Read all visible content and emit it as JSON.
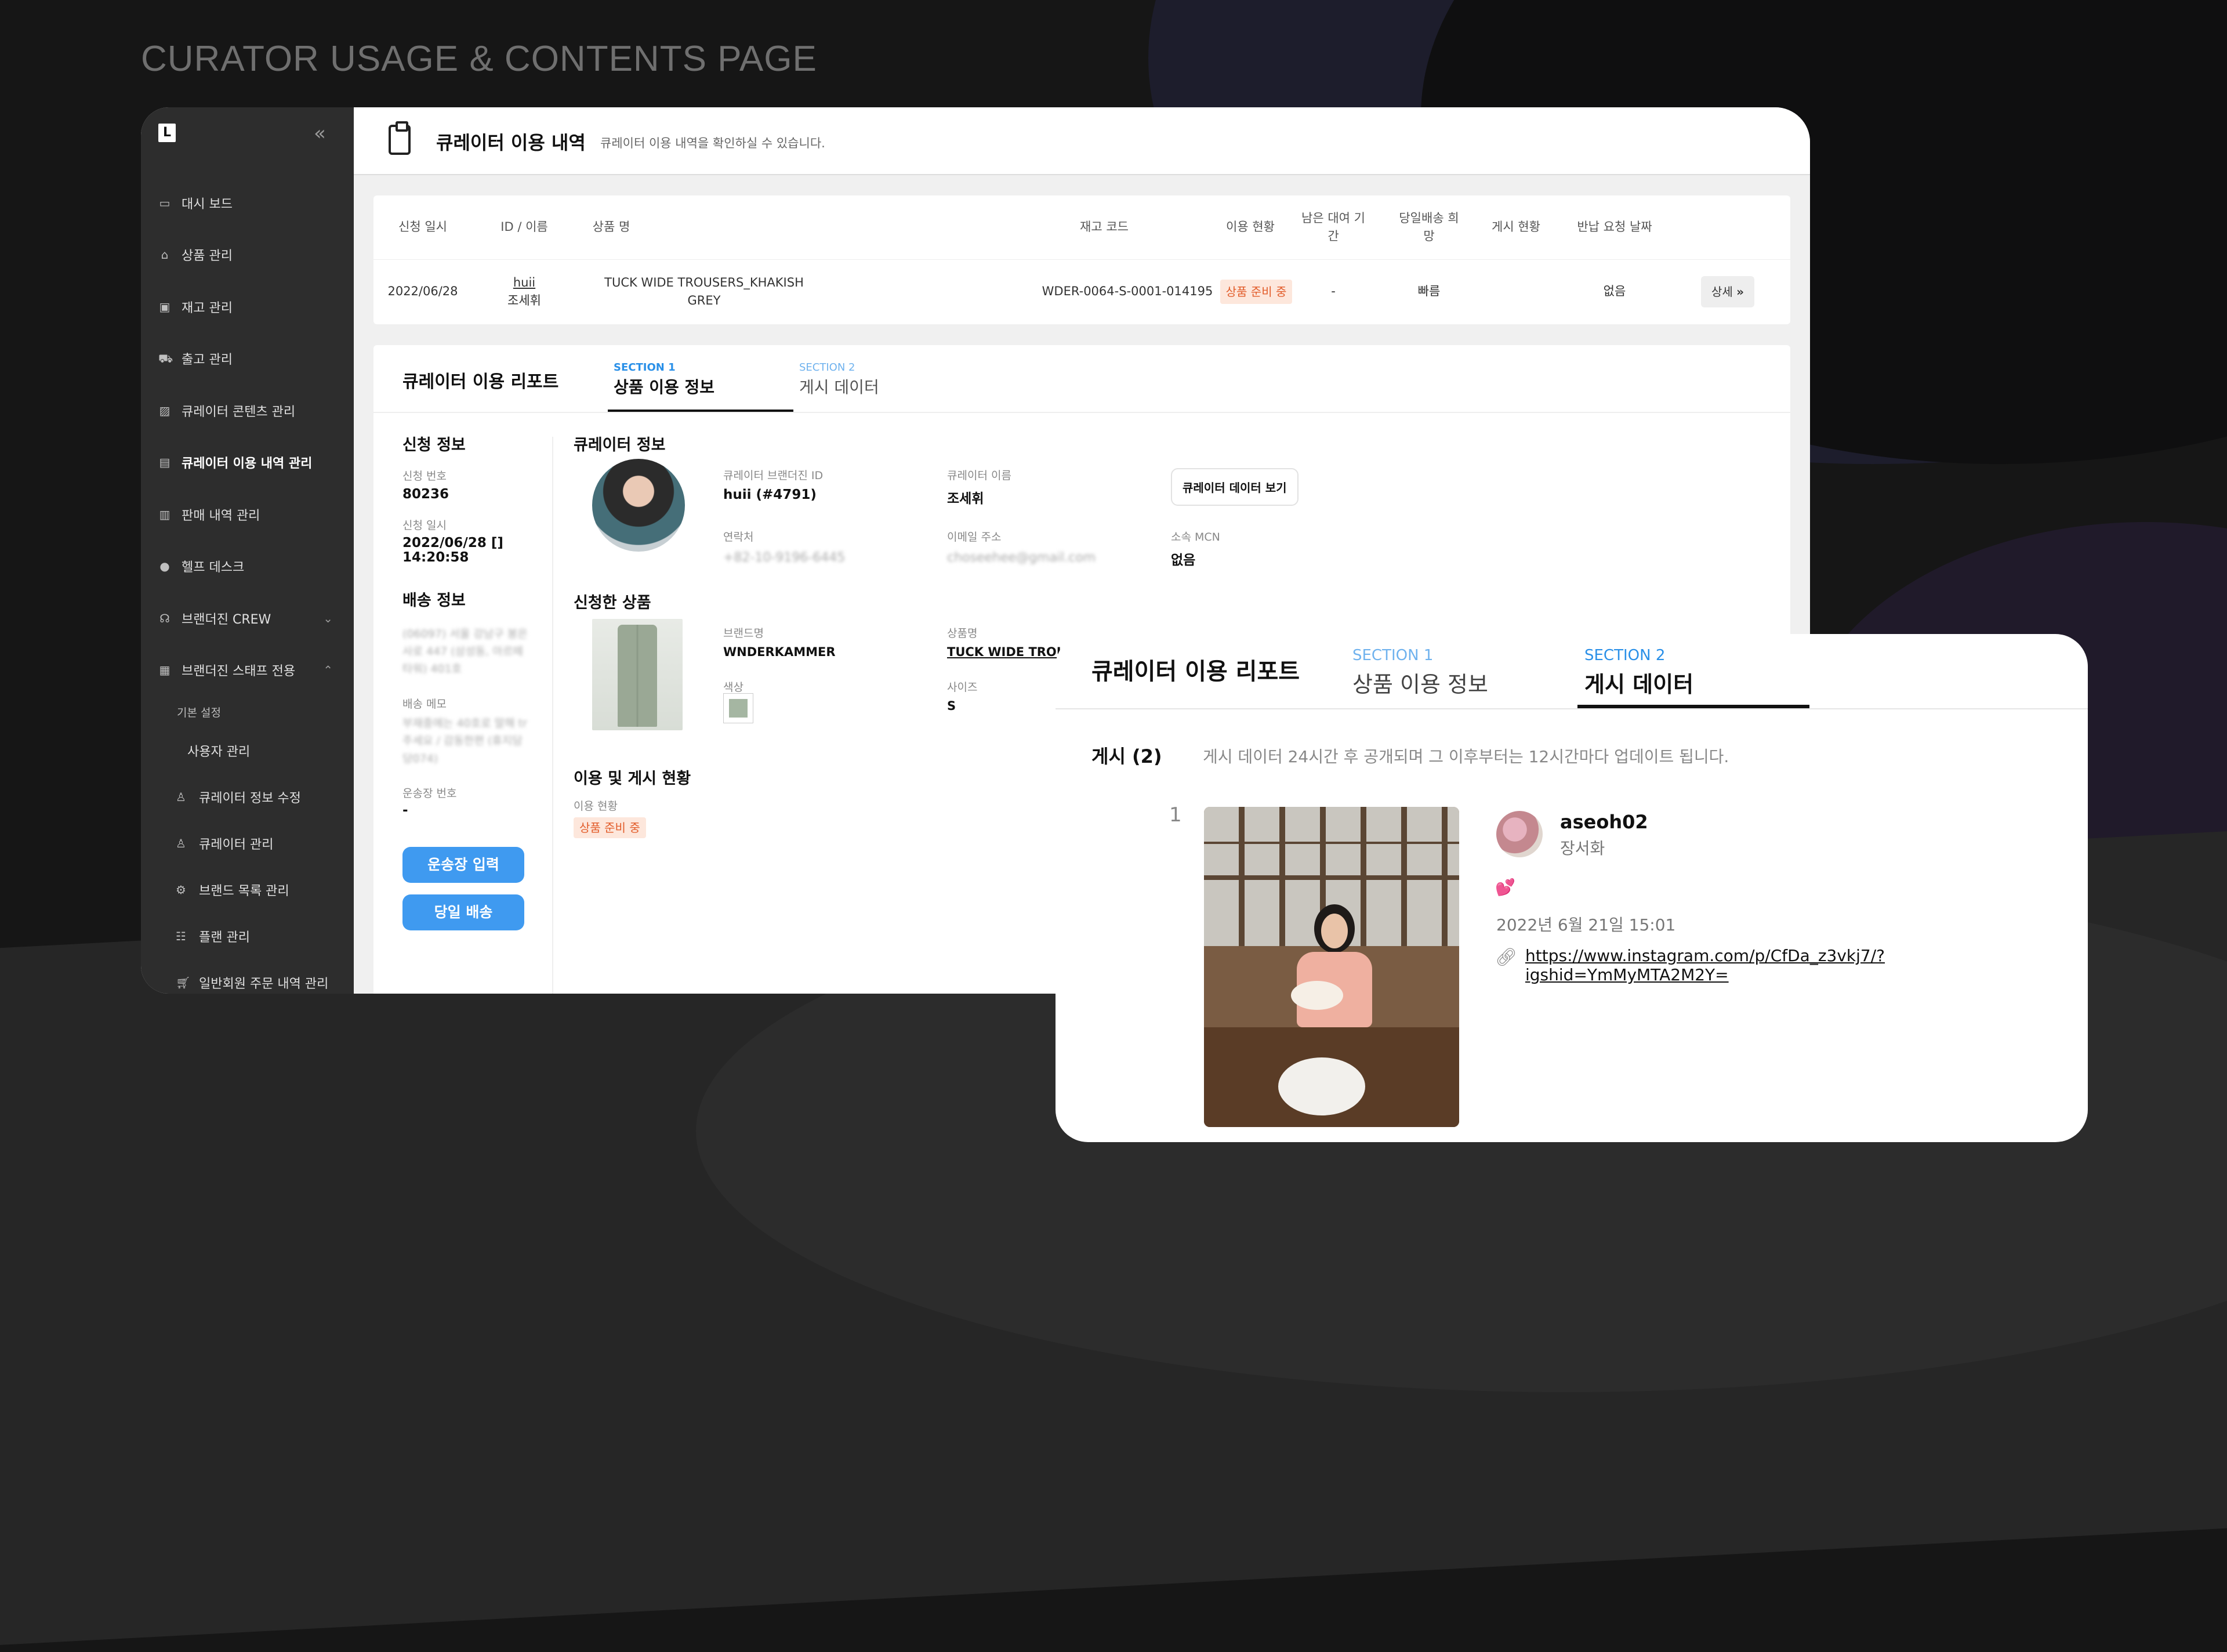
{
  "page_title": "CURATOR USAGE & CONTENTS PAGE",
  "sidebar": {
    "logo": "L",
    "collapse_icon": "double-chevron-left",
    "items": [
      {
        "label": "대시 보드",
        "icon": "dashboard-icon"
      },
      {
        "label": "상품 관리",
        "icon": "bag-icon"
      },
      {
        "label": "재고 관리",
        "icon": "box-icon"
      },
      {
        "label": "출고 관리",
        "icon": "truck-icon"
      },
      {
        "label": "큐레이터 콘텐츠 관리",
        "icon": "image-icon"
      },
      {
        "label": "큐레이터 이용 내역 관리",
        "icon": "briefcase-icon",
        "active": true
      },
      {
        "label": "판매 내역 관리",
        "icon": "receipt-icon"
      },
      {
        "label": "헬프 데스크",
        "icon": "info-icon"
      },
      {
        "label": "브랜더진 CREW",
        "icon": "headset-icon"
      },
      {
        "label": "브랜더진 스태프 전용",
        "icon": "grid-icon"
      }
    ],
    "sub_label": "기본 설정",
    "sub_items": [
      {
        "label": "사용자 관리",
        "icon": ""
      },
      {
        "label": "큐레이터 정보 수정",
        "icon": "user-icon"
      },
      {
        "label": "큐레이터 관리",
        "icon": "user-icon"
      },
      {
        "label": "브랜드 목록 관리",
        "icon": "gears-icon"
      },
      {
        "label": "플랜 관리",
        "icon": "sliders-icon"
      },
      {
        "label": "일반회원 주문 내역 관리",
        "icon": "cart-icon"
      }
    ]
  },
  "topbar": {
    "title": "큐레이터 이용 내역",
    "subtitle": "큐레이터 이용 내역을 확인하실 수 있습니다."
  },
  "table": {
    "headers": [
      "신청 일시",
      "ID / 이름",
      "상품 명",
      "재고 코드",
      "이용 현황",
      "남은 대여 기간",
      "당일배송 희망",
      "게시 현황",
      "반납 요청 날짜"
    ],
    "row": {
      "date": "2022/06/28",
      "id": "huii",
      "name": "조세휘",
      "product": "TUCK WIDE TROUSERS_KHAKISH GREY",
      "stock_code": "WDER-0064-S-0001-014195",
      "status": "상품 준비 중",
      "remaining": "-",
      "same_day": "빠름",
      "post_status": "",
      "return_date": "없음",
      "detail_button": "상세"
    }
  },
  "report": {
    "title": "큐레이터 이용 리포트",
    "tabs": [
      {
        "section": "SECTION 1",
        "name": "상품 이용 정보"
      },
      {
        "section": "SECTION 2",
        "name": "게시 데이터"
      }
    ],
    "application": {
      "heading": "신청 정보",
      "no_label": "신청 번호",
      "no_value": "80236",
      "date_label": "신청 일시",
      "date_value_1": "2022/06/28 []",
      "date_value_2": "14:20:58"
    },
    "shipping": {
      "heading": "배송 정보",
      "address": "(06097) 서울 강남구 봉은사로 447 (삼성동, 아르떼 타워) 401호",
      "memo_label": "배송 메모",
      "memo": "부재중에는 40호로 말해 tr 주세요 / 감동한편 (휴지담당074)",
      "tracking_label": "운송장 번호",
      "tracking_value": "-",
      "btn_tracking": "운송장 입력",
      "btn_sameday": "당일 배송"
    },
    "curator": {
      "heading": "큐레이터 정보",
      "brand_id_label": "큐레이터 브랜더진 ID",
      "brand_id_value": "huii (#4791)",
      "name_label": "큐레이터 이름",
      "name_value": "조세휘",
      "data_button": "큐레이터 데이터 보기",
      "contact_label": "연락처",
      "contact_value": "+82-10-9196-6445",
      "email_label": "이메일 주소",
      "email_value": "choseehee@gmail.com",
      "mcn_label": "소속 MCN",
      "mcn_value": "없음"
    },
    "product": {
      "heading": "신청한 상품",
      "brand_label": "브랜드명",
      "brand_value": "WNDERKAMMER",
      "name_label": "상품명",
      "name_value": "TUCK WIDE TROUSERS_KHAKISH GREY",
      "color_label": "색상",
      "size_label": "사이즈",
      "size_value": "S"
    },
    "usage": {
      "heading": "이용 및 게시 현황",
      "status_label": "이용 현황",
      "status_value": "상품 준비 중"
    }
  },
  "overlay": {
    "title": "큐레이터 이용 리포트",
    "tabs": [
      {
        "section": "SECTION 1",
        "name": "상품 이용 정보"
      },
      {
        "section": "SECTION 2",
        "name": "게시 데이터"
      }
    ],
    "post_heading": "게시 (2)",
    "post_note": "게시 데이터 24시간 후 공개되며 그 이후부터는 12시간마다 업데이트 됩니다.",
    "post": {
      "index": "1",
      "username": "aseoh02",
      "real_name": "장서화",
      "emoji": "💕",
      "date": "2022년 6월 21일 15:01",
      "url": "https://www.instagram.com/p/CfDa_z3vkj7/?igshid=YmMyMTA2M2Y="
    }
  }
}
